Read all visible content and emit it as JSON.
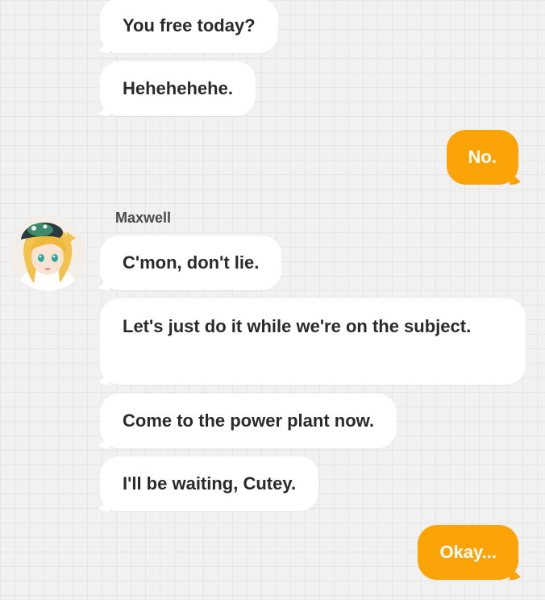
{
  "chat": {
    "sender_name": "Maxwell",
    "messages": [
      {
        "from": "contact",
        "text": "You free today?"
      },
      {
        "from": "contact",
        "text": "Hehehehehe."
      },
      {
        "from": "me",
        "text": "No."
      },
      {
        "from": "contact",
        "text": "C'mon, don't lie."
      },
      {
        "from": "contact",
        "text": "Let's just do it while we're on the subject."
      },
      {
        "from": "contact",
        "text": "Come to the power plant now."
      },
      {
        "from": "contact",
        "text": "I'll be waiting, Cutey."
      },
      {
        "from": "me",
        "text": "Okay..."
      }
    ]
  },
  "colors": {
    "outgoing_bubble": "#fba307",
    "incoming_bubble": "#ffffff",
    "background": "#f1f1f1"
  },
  "icons": {
    "avatar": "anime-character-avatar"
  }
}
